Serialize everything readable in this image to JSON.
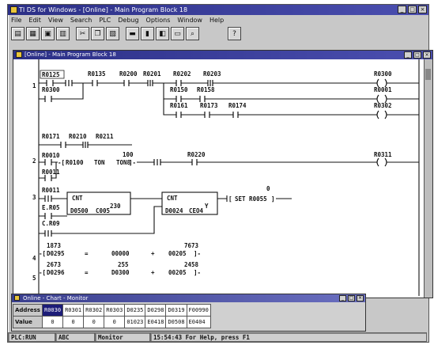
{
  "app": {
    "title": "TI DS for Windows - [Online] - Main Program Block 18",
    "controls": [
      "_",
      "□",
      "×"
    ]
  },
  "menu": [
    "File",
    "Edit",
    "View",
    "Search",
    "PLC",
    "Debug",
    "Options",
    "Window",
    "Help"
  ],
  "toolbar": {
    "icons": [
      "new-icon",
      "open-icon",
      "save-icon",
      "print-icon",
      "cut-icon",
      "copy-icon",
      "paste-icon",
      "ladder-icon",
      "monitor-icon",
      "compile-icon",
      "download-icon",
      "find-icon",
      "help-icon"
    ],
    "glyphs": [
      "▤",
      "▦",
      "▣",
      "▥",
      "✂",
      "❐",
      "▧",
      "▬",
      "▮",
      "◧",
      "▭",
      "⌕",
      "?"
    ]
  },
  "editor": {
    "title": "[Online] - Main Program Block 18",
    "rungs": [
      "1",
      "2",
      "3",
      "4",
      "5"
    ],
    "contacts": [
      "R0125",
      "R0135",
      "R0200",
      "R0201",
      "R0202",
      "R0203",
      "R0300",
      "R0150",
      "R0158",
      "R0161",
      "R0173",
      "R0174",
      "R0171",
      "R0210",
      "R0211",
      "R0010",
      "R0011",
      "R0220",
      "R0311",
      "R0001",
      "R0302",
      "E.R05",
      "C.R09"
    ],
    "coil_rung1": "R0300",
    "coil_rung1b": "R0001",
    "coil_rung1c": "R0302",
    "coil_rung2": "R0311",
    "timer": {
      "name": "R0100",
      "type": "TON",
      "label": "TON8",
      "preset": "100"
    },
    "counters": [
      {
        "label": "CNT",
        "acc": "D0500",
        "preset_label": "C005",
        "preset": "230"
      },
      {
        "label": "CNT",
        "acc": "D0024",
        "preset_label": "CEO4",
        "preset": "Y"
      }
    ],
    "set_box": "SET R0055",
    "set_small": "0",
    "math": [
      {
        "top": "1873",
        "dest": "D0295",
        "op1": "00000",
        "val2": "7673",
        "op2": "00205",
        "top2": "2673",
        "rung": "4"
      },
      {
        "top": "2673",
        "dest": "D0296",
        "op1": "D0300",
        "val2": "2458",
        "op2": "00205",
        "top2": "255",
        "rung": "5"
      }
    ]
  },
  "monitor": {
    "title": "Online - Chart - Monitor",
    "address_label": "Address",
    "value_label": "Value",
    "addresses": [
      "R0030",
      "R0301",
      "R0302",
      "R0303",
      "D0235",
      "D0298",
      "D0319",
      "F00990"
    ],
    "values": [
      "0",
      "0",
      "0",
      "0",
      "01023",
      "E0418",
      "D0508",
      "E0404"
    ]
  },
  "status": {
    "mode": "PLC:RUN",
    "units": "ABC",
    "state": "Monitor",
    "message": "15:54:43 For Help, press F1"
  }
}
